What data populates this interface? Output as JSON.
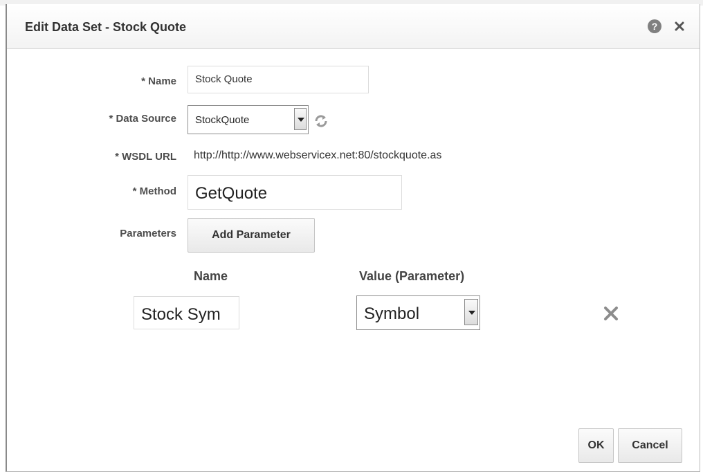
{
  "dialog": {
    "title": "Edit Data Set - Stock Quote",
    "help_icon": "question-circle-icon",
    "close_icon": "close-x-icon"
  },
  "form": {
    "required_marker": "*",
    "name_label": "Name",
    "name_value": "Stock Quote",
    "data_source_label": "Data Source",
    "data_source_value": "StockQuote",
    "refresh_icon": "refresh-icon",
    "wsdl_label": "WSDL URL",
    "wsdl_value": "http://http://www.webservicex.net:80/stockquote.as",
    "method_label": "Method",
    "method_value": "GetQuote",
    "parameters_label": "Parameters",
    "add_parameter_label": "Add Parameter"
  },
  "parameters_table": {
    "headers": [
      "Name",
      "Value (Parameter)"
    ],
    "rows": [
      {
        "name": "Stock Sym",
        "value": "Symbol"
      }
    ],
    "delete_icon": "delete-x-icon"
  },
  "footer": {
    "ok_label": "OK",
    "cancel_label": "Cancel"
  },
  "colors": {
    "label_text": "#4d4d4d",
    "icon_gray": "#808080",
    "border": "#dcdcdc"
  }
}
